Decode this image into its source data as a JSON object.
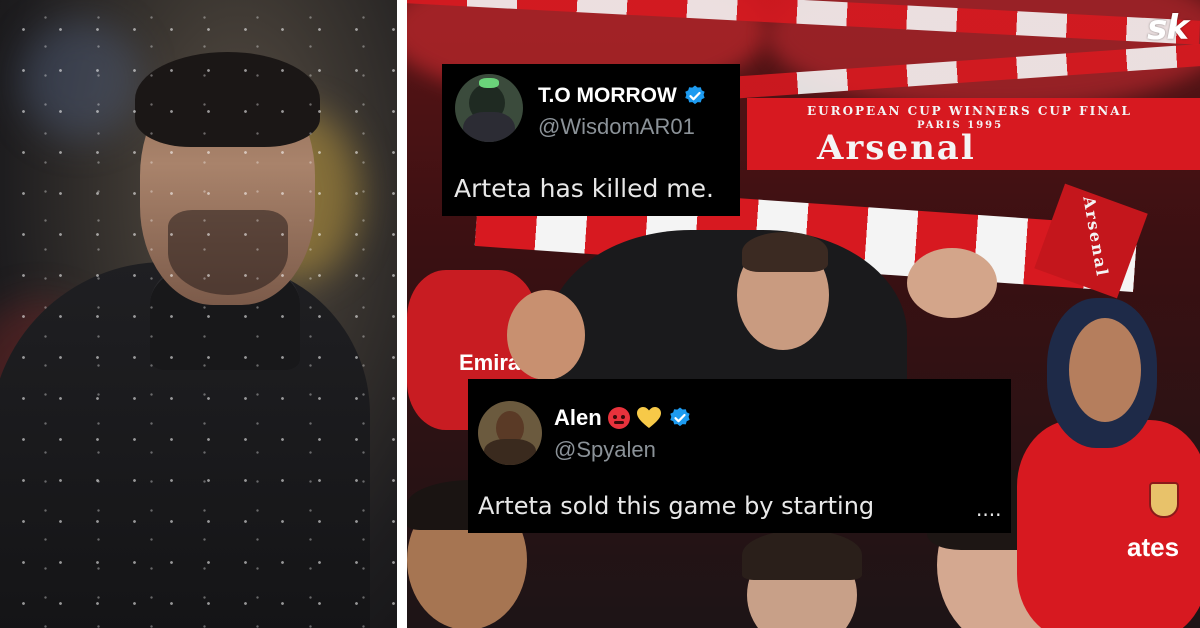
{
  "logo": {
    "text": "sk"
  },
  "tweets": [
    {
      "name": "T.O MORROW",
      "handle": "@WisdomAR01",
      "text": "Arteta has killed me.",
      "verified": true
    },
    {
      "name": "Alen",
      "handle": "@Spyalen",
      "text": "Arteta sold this game by starting",
      "trailing": "....",
      "verified": true,
      "emojis": [
        "angry-face-emoji",
        "yellow-heart-emoji"
      ]
    }
  ],
  "scarves": [
    {
      "line1": "EUROPEAN CUP WINNERS CUP FINAL",
      "line2": "PARIS 1995",
      "word": "Arsenal"
    },
    {
      "word": "Arsenal"
    }
  ],
  "shirt_sponsor": "Emira",
  "shirt_sponsor_right": "ates",
  "colors": {
    "arsenal_red": "#d71920",
    "verified_blue": "#1d9bf0",
    "tweet_bg": "#000000",
    "handle_grey": "#8b9298"
  }
}
